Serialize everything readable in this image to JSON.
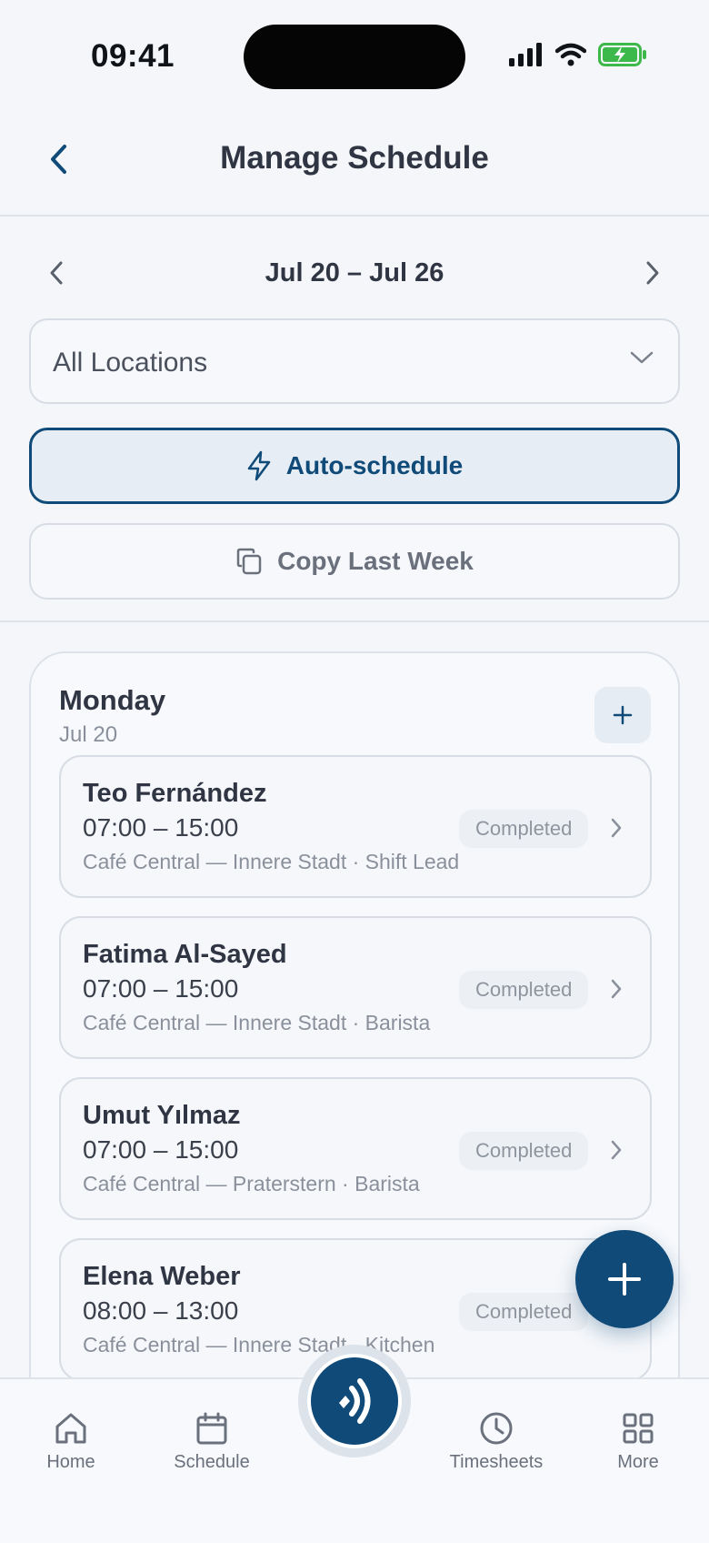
{
  "status_bar": {
    "time": "09:41"
  },
  "header": {
    "title": "Manage Schedule"
  },
  "week": {
    "label": "Jul 20 – Jul 26"
  },
  "location_select": {
    "value": "All Locations"
  },
  "actions": {
    "auto_schedule": "Auto-schedule",
    "copy_last_week": "Copy Last Week"
  },
  "day": {
    "name": "Monday",
    "date": "Jul 20",
    "shifts": [
      {
        "name": "Teo Fernández",
        "hours": "07:00 – 15:00",
        "place": "Café Central — Innere Stadt · Shift Lead",
        "status": "Completed"
      },
      {
        "name": "Fatima Al-Sayed",
        "hours": "07:00 – 15:00",
        "place": "Café Central — Innere Stadt · Barista",
        "status": "Completed"
      },
      {
        "name": "Umut Yılmaz",
        "hours": "07:00 – 15:00",
        "place": "Café Central — Praterstern · Barista",
        "status": "Completed"
      },
      {
        "name": "Elena Weber",
        "hours": "08:00 – 13:00",
        "place": "Café Central — Innere Stadt · Kitchen",
        "status": "Completed"
      }
    ]
  },
  "tabbar": {
    "home": "Home",
    "schedule": "Schedule",
    "timesheets": "Timesheets",
    "more": "More"
  },
  "colors": {
    "primary": "#0f4a78",
    "background": "#f4f6fa",
    "text": "#2f3542",
    "muted": "#8a909b"
  },
  "icons": [
    "back-icon",
    "chevron-left-icon",
    "chevron-right-icon",
    "chevron-down-icon",
    "bolt-icon",
    "copy-icon",
    "plus-icon",
    "home-icon",
    "calendar-icon",
    "voice-icon",
    "clock-icon",
    "grid-icon"
  ]
}
